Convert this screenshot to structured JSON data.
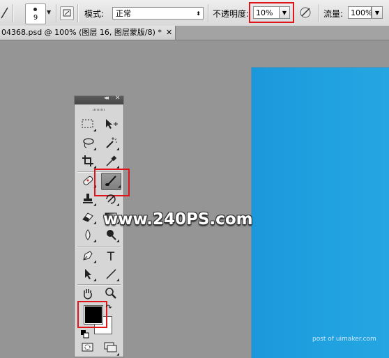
{
  "options_bar": {
    "brush_size": "9",
    "mode_label": "模式:",
    "mode_value": "正常",
    "opacity_label": "不透明度:",
    "opacity_value": "10%",
    "flow_label": "流量:",
    "flow_value": "100%",
    "icons": [
      "brush-tool-icon",
      "brush-preset-dropdown-icon",
      "toggle-brush-panel-icon",
      "pressure-opacity-icon"
    ]
  },
  "document_tab": {
    "title": "04368.psd @ 100% (图层 16, 图层蒙版/8) *",
    "close_glyph": "✕"
  },
  "tools_panel": {
    "collapse_glyph": "◂◂",
    "close_glyph": "✕",
    "text_tool_glyph": "T",
    "icons": [
      "marquee-icon",
      "move-icon",
      "lasso-icon",
      "magic-wand-icon",
      "crop-icon",
      "eyedropper-icon",
      "healing-brush-icon",
      "brush-icon",
      "clone-stamp-icon",
      "history-brush-icon",
      "eraser-icon",
      "gradient-icon",
      "blur-icon",
      "dodge-icon",
      "pen-icon",
      "type-icon",
      "path-selection-icon",
      "line-icon",
      "hand-icon",
      "zoom-icon",
      "swap-colors-icon",
      "default-colors-icon",
      "quick-mask-icon",
      "screen-mode-icon"
    ],
    "foreground_color": "#000000",
    "background_color": "#ffffff"
  },
  "watermark": {
    "text": "www.240PS.com"
  },
  "canvas_watermark": {
    "text": "post of uimaker.com"
  },
  "colors": {
    "canvas_blue": "#1f9fde",
    "highlight_red": "#e0141b",
    "workspace_gray": "#959595"
  }
}
